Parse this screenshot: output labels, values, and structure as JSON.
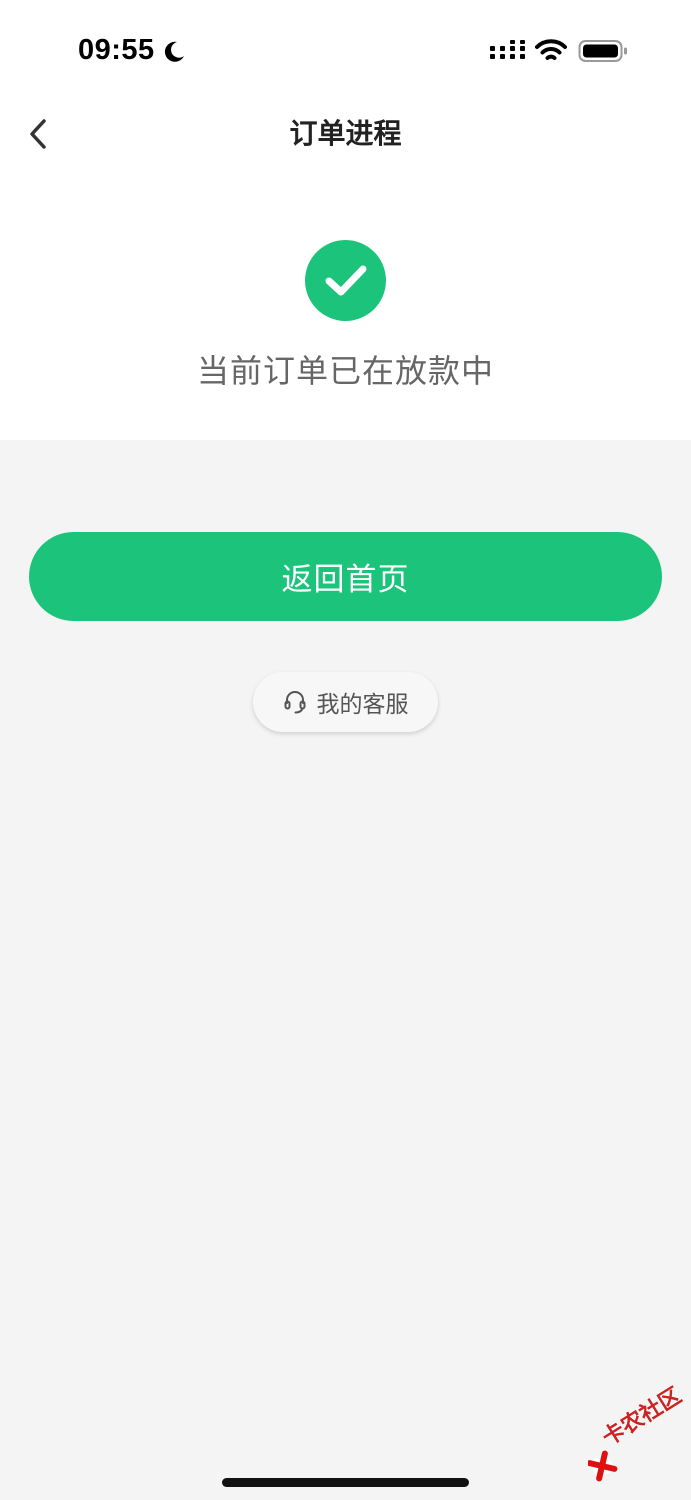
{
  "status_bar": {
    "time": "09:55",
    "moon_icon": "moon-icon",
    "signal_icon": "cellular-signal-icon",
    "wifi_icon": "wifi-icon",
    "battery_icon": "battery-icon"
  },
  "nav": {
    "back_icon": "chevron-left-icon",
    "title": "订单进程"
  },
  "result": {
    "icon": "check-circle-icon",
    "message": "当前订单已在放款中"
  },
  "actions": {
    "home_label": "返回首页",
    "service_label": "我的客服",
    "service_icon": "headset-icon"
  },
  "watermark": {
    "text": "卡农社区",
    "icon": "kanong-logo-icon"
  },
  "colors": {
    "accent": "#1bc47a",
    "background": "#f4f4f4",
    "card": "#ffffff",
    "title_text": "#222222",
    "body_text": "#666666"
  }
}
